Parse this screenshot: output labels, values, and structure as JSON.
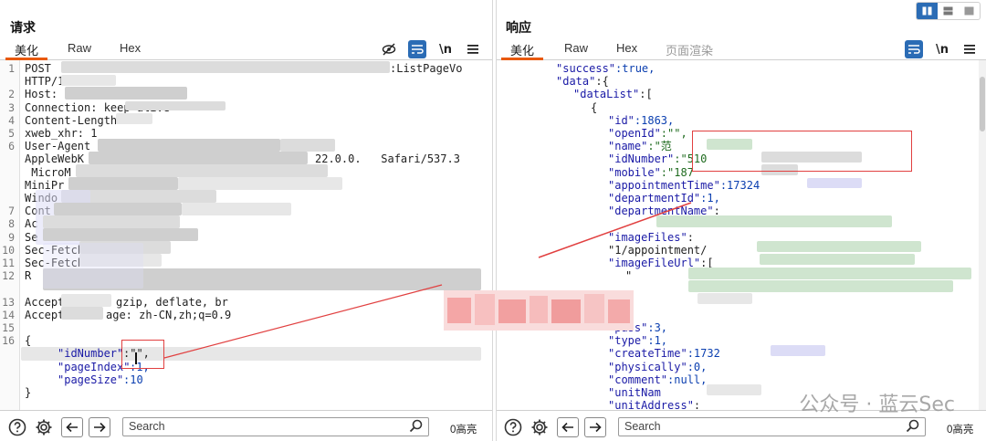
{
  "request": {
    "title": "请求",
    "tabs": [
      "美化",
      "Raw",
      "Hex"
    ],
    "tool_newline": "\\n",
    "lines": [
      {
        "n": "1",
        "text": "POST "
      },
      {
        "n": "",
        "text": "HTTP/1."
      },
      {
        "n": "2",
        "text": "Host: "
      },
      {
        "n": "3",
        "text": "Connection: keep-alive"
      },
      {
        "n": "4",
        "text": "Content-Length:"
      },
      {
        "n": "5",
        "text": "xweb_xhr: 1"
      },
      {
        "n": "6",
        "text": "User-Agent"
      },
      {
        "n": "",
        "text": "AppleWebK"
      },
      {
        "n": "",
        "text": " MicroM"
      },
      {
        "n": "",
        "text": "MiniPr"
      },
      {
        "n": "",
        "text": "Windo"
      },
      {
        "n": "7",
        "text": "Cont"
      },
      {
        "n": "8",
        "text": "Ac"
      },
      {
        "n": "9",
        "text": "Se"
      },
      {
        "n": "10",
        "text": "Sec-Fetch-Mo"
      },
      {
        "n": "11",
        "text": "Sec-Fetch-De"
      },
      {
        "n": "12",
        "text": "R"
      },
      {
        "n": "",
        "text": ""
      },
      {
        "n": "13",
        "text": "Accept-E"
      },
      {
        "n": "14",
        "text": "Accept-L"
      },
      {
        "n": "15",
        "text": ""
      },
      {
        "n": "16",
        "text": "{"
      },
      {
        "n": "",
        "text": ""
      },
      {
        "n": "",
        "text": ""
      },
      {
        "n": "",
        "text": ""
      },
      {
        "n": "",
        "text": "}"
      }
    ],
    "line1_suffix": ":ListPageVo",
    "line6_safari": "22.0.0.   Safari/537.3",
    "accept_encoding_value": "gzip, deflate, br",
    "accept_language_value": "age: zh-CN,zh;q=0.9",
    "json_keys": {
      "idNumber": "\"idNumber\"",
      "idNumber_val": ":\"\",",
      "pageIndex": "\"pageIndex\"",
      "pageIndex_val": ":1,",
      "pageSize": "\"pageSize\"",
      "pageSize_val": ":10"
    },
    "search_placeholder": "Search",
    "highlight_count": "0高亮"
  },
  "response": {
    "title": "响应",
    "tabs": [
      "美化",
      "Raw",
      "Hex",
      "页面渲染"
    ],
    "tool_newline": "\\n",
    "lines": [
      {
        "ind": 3,
        "k": "\"success\"",
        "v": ":true,"
      },
      {
        "ind": 3,
        "k": "\"data\"",
        "v": ":{"
      },
      {
        "ind": 4,
        "k": "\"dataList\"",
        "v": ":["
      },
      {
        "ind": 5,
        "k": "",
        "v": "{"
      },
      {
        "ind": 6,
        "k": "\"id\"",
        "v": ":1863,"
      },
      {
        "ind": 6,
        "k": "\"openId\"",
        "v": ":\"\","
      },
      {
        "ind": 6,
        "k": "\"name\"",
        "v": ":\"范"
      },
      {
        "ind": 6,
        "k": "\"idNumber\"",
        "v": ":\"510"
      },
      {
        "ind": 6,
        "k": "\"mobile\"",
        "v": ":\"187"
      },
      {
        "ind": 6,
        "k": "\"appointmentTime\"",
        "v": ":17324"
      },
      {
        "ind": 6,
        "k": "\"departmentId\"",
        "v": ":1,"
      },
      {
        "ind": 6,
        "k": "\"departmentName\"",
        "v": ":"
      },
      {
        "ind": 6,
        "k": "",
        "v": ""
      },
      {
        "ind": 6,
        "k": "\"imageFiles\"",
        "v": ":"
      },
      {
        "ind": 6,
        "k": "",
        "v": "\"1/appointment/"
      },
      {
        "ind": 6,
        "k": "\"imageFileUrl\"",
        "v": ":["
      },
      {
        "ind": 7,
        "k": "",
        "v": "\""
      },
      {
        "ind": 7,
        "k": "",
        "v": ""
      },
      {
        "ind": 7,
        "k": "",
        "v": ""
      },
      {
        "ind": 6,
        "k": "",
        "v": "],"
      },
      {
        "ind": 6,
        "k": "\"pass\"",
        "v": ":3,"
      },
      {
        "ind": 6,
        "k": "\"type\"",
        "v": ":1,"
      },
      {
        "ind": 6,
        "k": "\"createTime\"",
        "v": ":1732"
      },
      {
        "ind": 6,
        "k": "\"physically\"",
        "v": ":0,"
      },
      {
        "ind": 6,
        "k": "\"comment\"",
        "v": ":null,"
      },
      {
        "ind": 6,
        "k": "\"unitNam",
        "v": ""
      },
      {
        "ind": 6,
        "k": "\"unitAddress\"",
        "v": ":"
      }
    ],
    "search_placeholder": "Search",
    "highlight_count": "0高亮"
  },
  "watermark": "公众号 · 蓝云Sec",
  "icons": {
    "help": "help-circle-icon",
    "settings": "gear-icon",
    "back": "arrow-left-icon",
    "forward": "arrow-right-icon",
    "search": "magnifier-icon",
    "hide": "eye-off-icon",
    "wrap": "wrap-lines-icon",
    "menu": "hamburger-icon"
  },
  "colors": {
    "accent": "#e8590c",
    "tool_blue": "#2b6cb5",
    "highlight_red": "#e14040",
    "key_blue": "#1a1aa6"
  }
}
